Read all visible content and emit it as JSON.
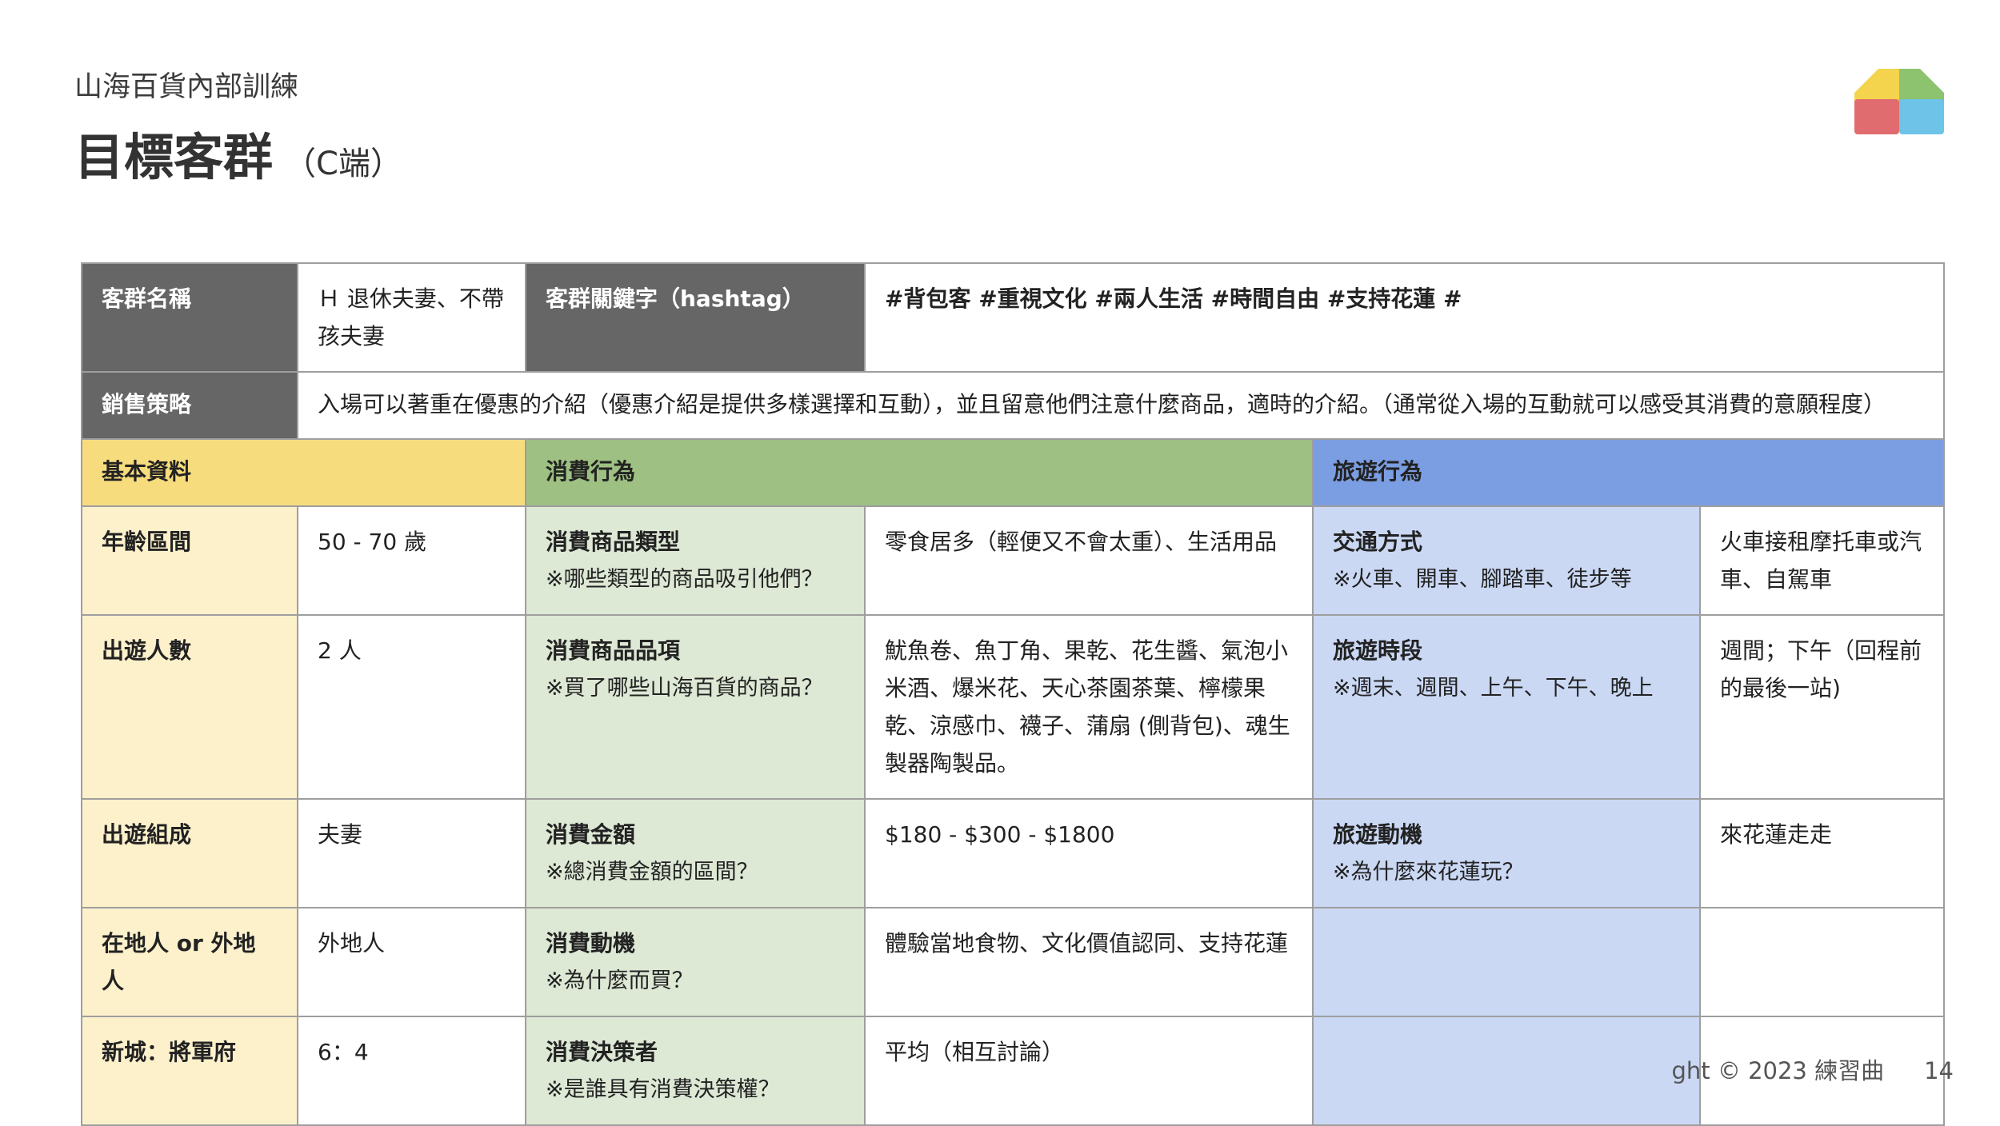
{
  "header": {
    "subtitle": "山海百貨內部訓練",
    "title": "目標客群",
    "title_suffix": "（C端）"
  },
  "colors": {
    "dark_header": "#666666",
    "basic_header": "#f7dc7e",
    "consumer_header": "#9ec083",
    "travel_header": "#7b9de2",
    "basic_light": "#fdf1cc",
    "consumer_light": "#dde8d5",
    "travel_light": "#cad8f4",
    "logo": [
      "#f4d44d",
      "#8dc26f",
      "#6ec3e8",
      "#e06c70"
    ]
  },
  "table": {
    "group_name_label": "客群名稱",
    "group_name_value": "Ｈ 退休夫妻、不帶孩夫妻",
    "hashtag_label": "客群關鍵字（hashtag）",
    "hashtag_value": "#背包客 #重視文化 #兩人生活 #時間自由 #支持花蓮 #",
    "strategy_label": "銷售策略",
    "strategy_value": "入場可以著重在優惠的介紹（優惠介紹是提供多樣選擇和互動），並且留意他們注意什麼商品，適時的介紹。（通常從入場的互動就可以感受其消費的意願程度）",
    "sections": {
      "basic": "基本資料",
      "consumer": "消費行為",
      "travel": "旅遊行為"
    },
    "rows": [
      {
        "basic_label": "年齡區間",
        "basic_value": "50 - 70 歲",
        "consumer_label": "消費商品類型",
        "consumer_hint": "※哪些類型的商品吸引他們？",
        "consumer_value": "零食居多（輕便又不會太重）、生活用品",
        "travel_label": "交通方式",
        "travel_hint": "※火車、開車、腳踏車、徒步等",
        "travel_value": "火車接租摩托車或汽車、自駕車"
      },
      {
        "basic_label": "出遊人數",
        "basic_value": "2 人",
        "consumer_label": "消費商品品項",
        "consumer_hint": "※買了哪些山海百貨的商品？",
        "consumer_value": "魷魚卷、魚丁角、果乾、花生醬、氣泡小米酒、爆米花、天心茶園茶葉、檸檬果乾、涼感巾、襪子、蒲扇 (側背包)、魂生製器陶製品。",
        "travel_label": "旅遊時段",
        "travel_hint": "※週末、週間、上午、下午、晚上",
        "travel_value": "週間；下午（回程前的最後一站)"
      },
      {
        "basic_label": "出遊組成",
        "basic_value": "夫妻",
        "consumer_label": "消費金額",
        "consumer_hint": "※總消費金額的區間？",
        "consumer_value": "$180 - $300 - $1800",
        "travel_label": "旅遊動機",
        "travel_hint": "※為什麼來花蓮玩？",
        "travel_value": "來花蓮走走"
      },
      {
        "basic_label": "在地人 or 外地人",
        "basic_value": "外地人",
        "consumer_label": "消費動機",
        "consumer_hint": "※為什麼而買？",
        "consumer_value": "體驗當地食物、文化價值認同、支持花蓮",
        "travel_label": "",
        "travel_hint": "",
        "travel_value": ""
      },
      {
        "basic_label": "新城：將軍府",
        "basic_value": "6：4",
        "consumer_label": "消費決策者",
        "consumer_hint": "※是誰具有消費決策權？",
        "consumer_value": "平均（相互討論）",
        "travel_label": "",
        "travel_hint": "",
        "travel_value": ""
      }
    ]
  },
  "footer": {
    "copyright": "ght © 2023 練習曲",
    "page_number": "14"
  }
}
